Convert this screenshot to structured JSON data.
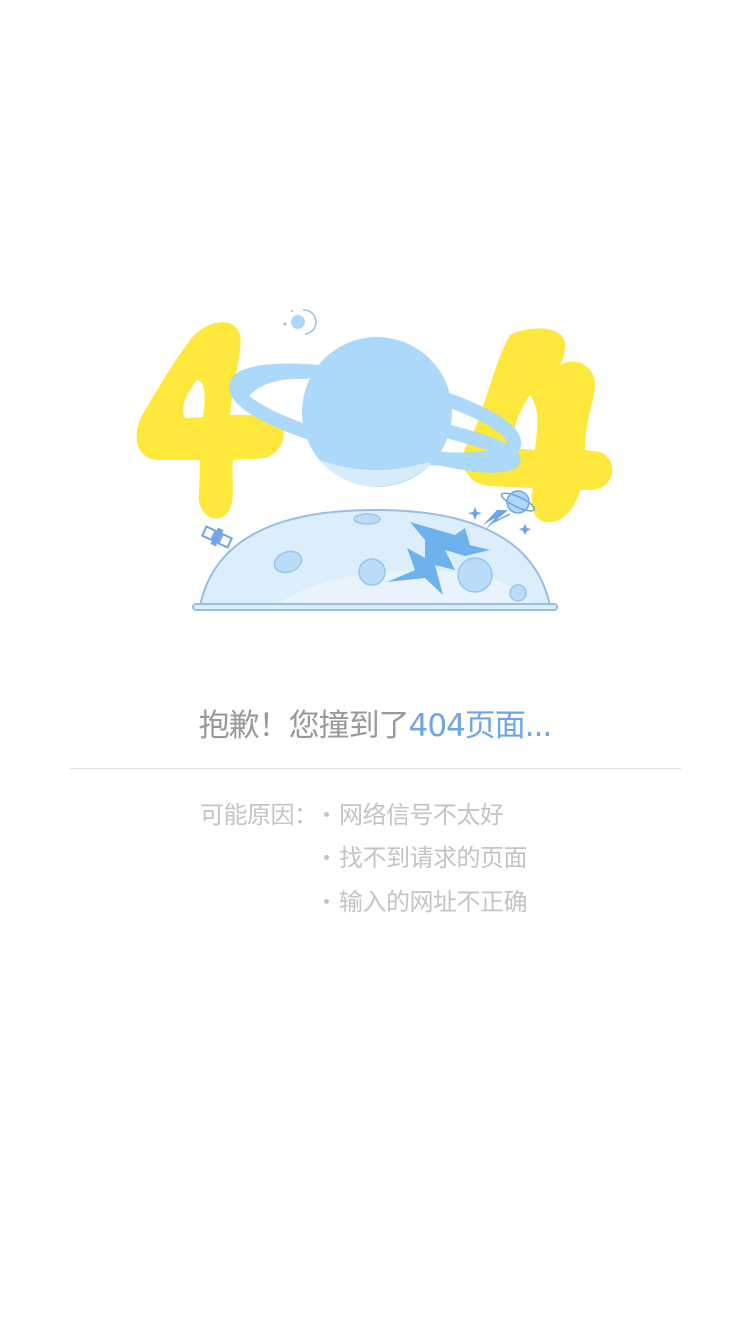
{
  "error": {
    "message_prefix": "抱歉！您撞到了",
    "message_suffix": "404页面...",
    "reasons_label": "可能原因：",
    "reasons": [
      "网络信号不太好",
      "找不到请求的页面",
      "输入的网址不正确"
    ]
  },
  "illustration": {
    "text": "404",
    "primary_color": "#ffe83c",
    "planet_color": "#acd8fa",
    "accent_color": "#6fa5e8"
  }
}
